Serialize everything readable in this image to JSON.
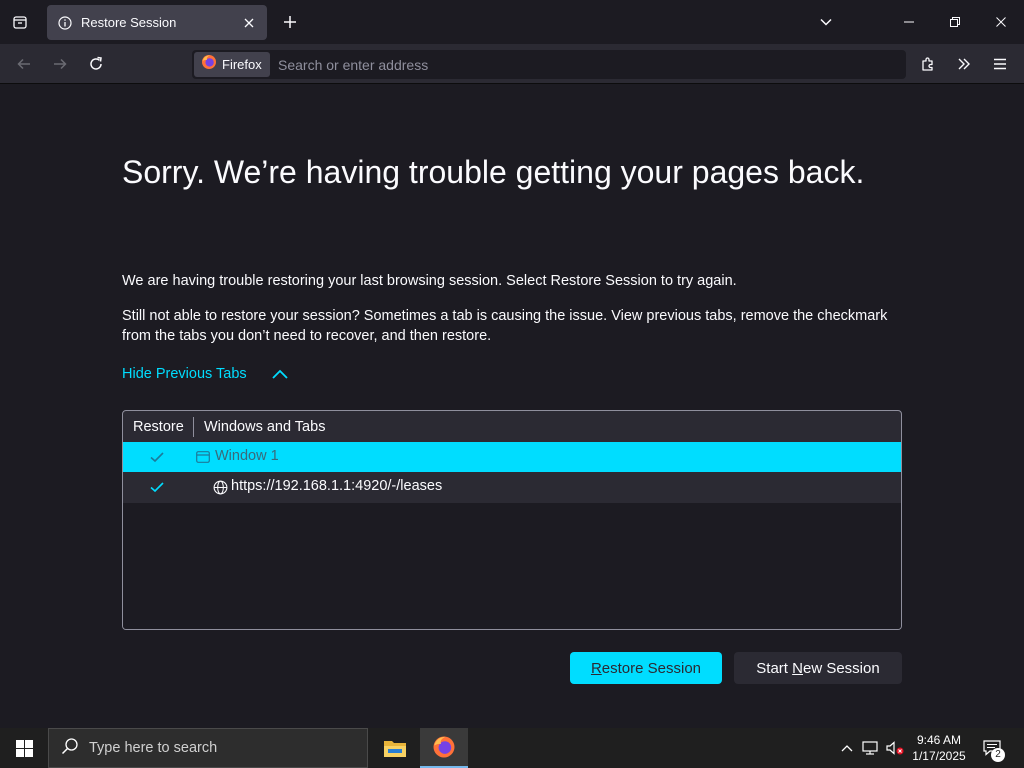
{
  "tabstrip": {
    "active_tab_title": "Restore Session"
  },
  "navbar": {
    "identity_label": "Firefox",
    "url_placeholder": "Search or enter address"
  },
  "page": {
    "heading": "Sorry. We’re having trouble getting your pages back.",
    "paragraph_1": "We are having trouble restoring your last browsing session. Select Restore Session to try again.",
    "paragraph_2": "Still not able to restore your session? Sometimes a tab is causing the issue. View previous tabs, remove the checkmark from the tabs you don’t need to recover, and then restore.",
    "toggle_label": "Hide Previous Tabs",
    "tree": {
      "col_restore": "Restore",
      "col_windows": "Windows and Tabs",
      "window_label": "Window 1",
      "tab_url": "https://192.168.1.1:4920/-/leases"
    },
    "restore_button": {
      "prefix": "",
      "accel": "R",
      "rest": "estore Session"
    },
    "new_session_button": {
      "prefix": "Start ",
      "accel": "N",
      "rest": "ew Session"
    }
  },
  "taskbar": {
    "search_placeholder": "Type here to search",
    "time": "9:46 AM",
    "date": "1/17/2025",
    "notification_count": "2"
  },
  "colors": {
    "accent": "#00ddff",
    "background": "#1c1b22",
    "toolbar": "#2b2a33"
  }
}
